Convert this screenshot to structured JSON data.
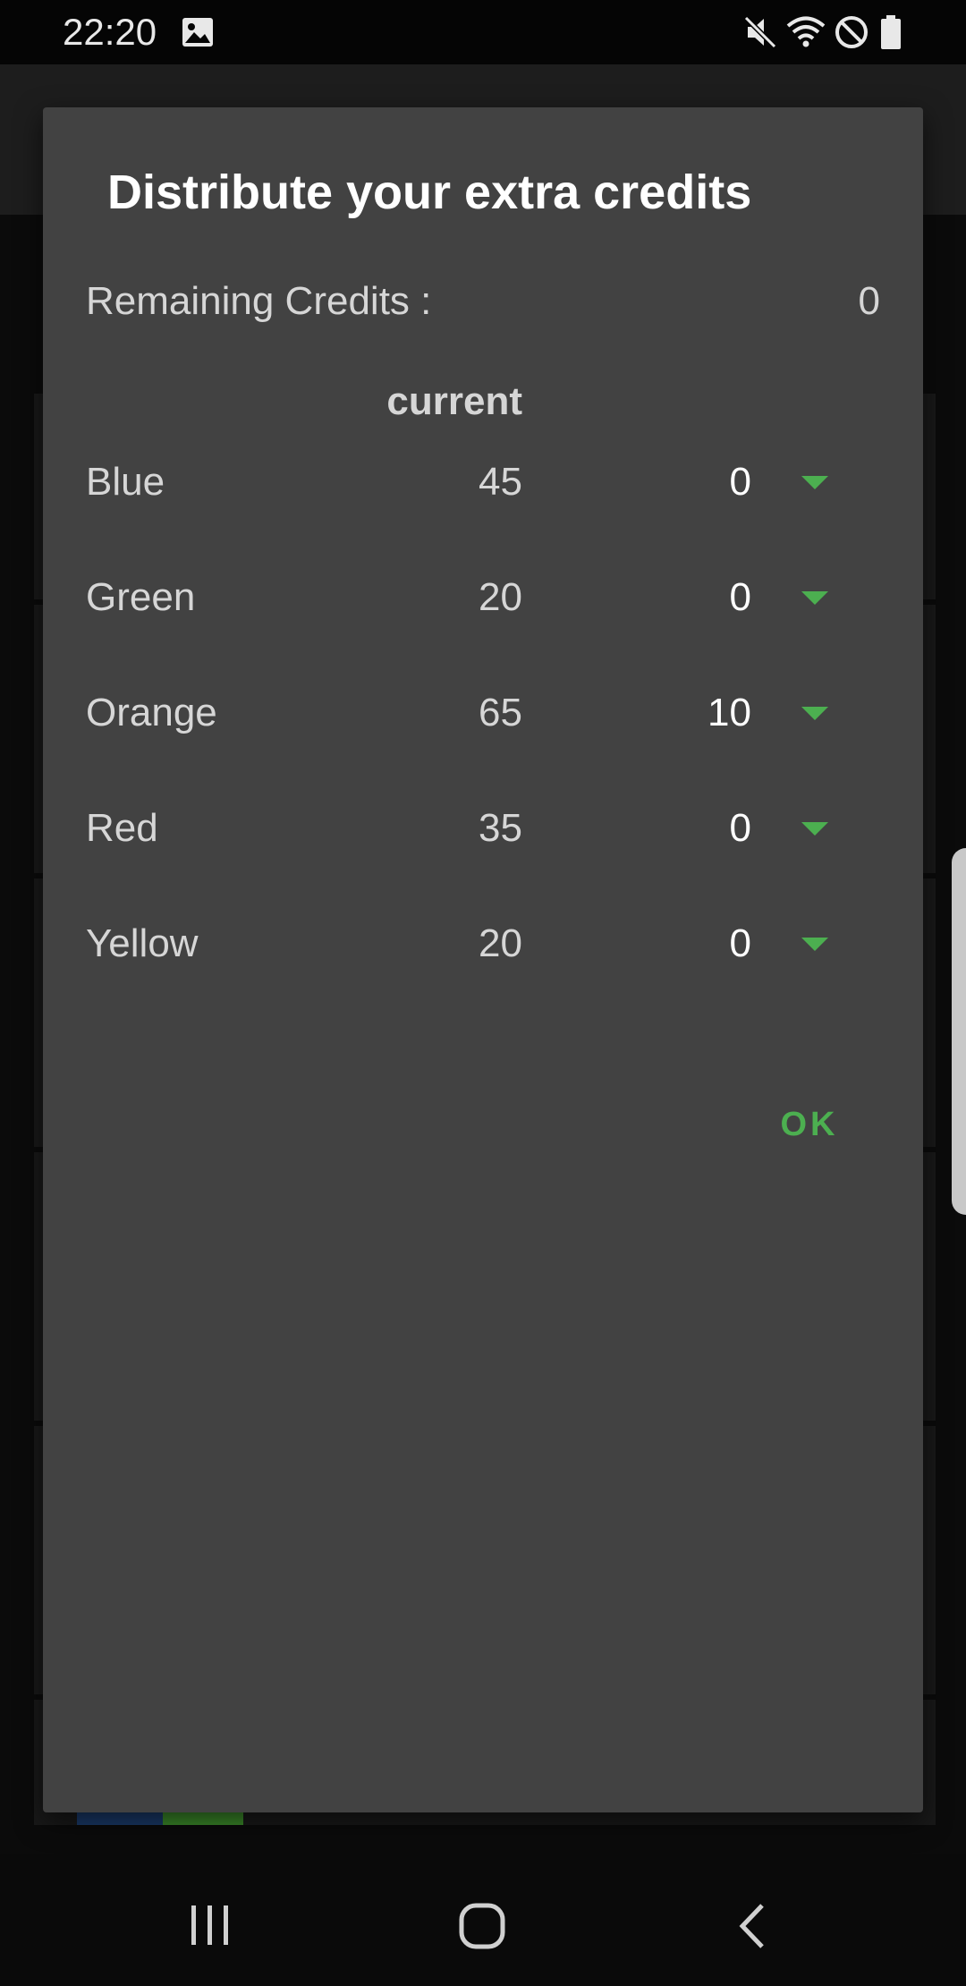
{
  "status_bar": {
    "time": "22:20",
    "icons": [
      "image-icon",
      "mute-icon",
      "wifi-icon",
      "do-not-disturb-icon",
      "battery-icon"
    ]
  },
  "dialog": {
    "title": "Distribute your extra credits",
    "remaining_label": "Remaining Credits :",
    "remaining_value": "0",
    "column_header": "current",
    "rows": [
      {
        "name": "Blue",
        "current": "45",
        "extra": "0"
      },
      {
        "name": "Green",
        "current": "20",
        "extra": "0"
      },
      {
        "name": "Orange",
        "current": "65",
        "extra": "10"
      },
      {
        "name": "Red",
        "current": "35",
        "extra": "0"
      },
      {
        "name": "Yellow",
        "current": "20",
        "extra": "0"
      }
    ],
    "ok_label": "OK"
  },
  "nav_bar": {
    "icons": [
      "recent-apps-icon",
      "home-icon",
      "back-icon"
    ]
  },
  "colors": {
    "accent": "#4caf50",
    "dialog_background": "#424242",
    "screen_background": "#0a0a0a"
  }
}
